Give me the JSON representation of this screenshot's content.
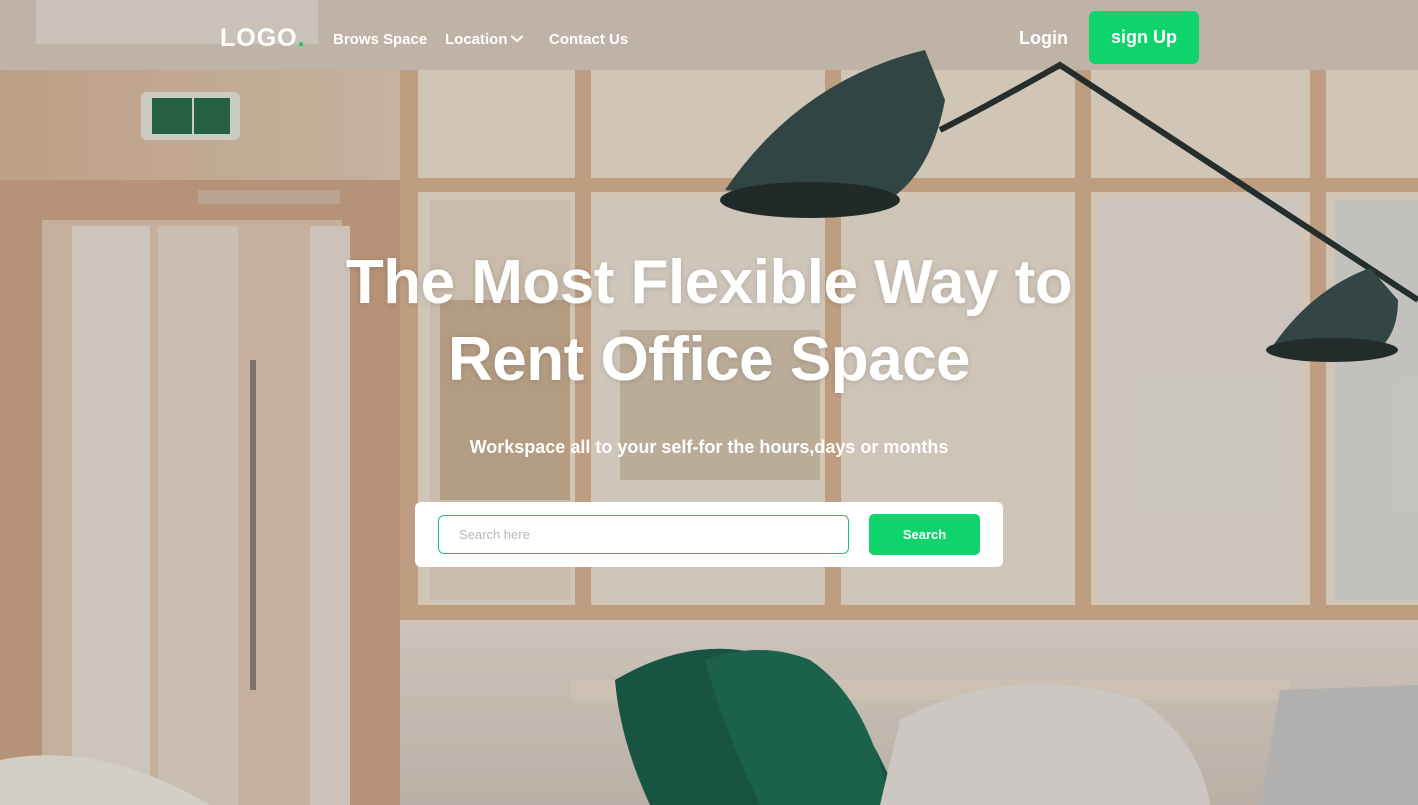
{
  "nav": {
    "logo_text": "LOGO",
    "logo_dot": ".",
    "links": [
      "Brows Space",
      "Location",
      "Contact Us"
    ],
    "login_label": "Login",
    "signup_label": "sign Up"
  },
  "hero": {
    "headline_line1": "The Most Flexible Way to",
    "headline_line2": "Rent Office Space",
    "subheadline": "Workspace all to your self-for the hours,days or months"
  },
  "search": {
    "placeholder": "Search here",
    "value": "",
    "button_label": "Search"
  },
  "colors": {
    "accent": "#0fd46c",
    "text_on_image": "#ffffff"
  }
}
